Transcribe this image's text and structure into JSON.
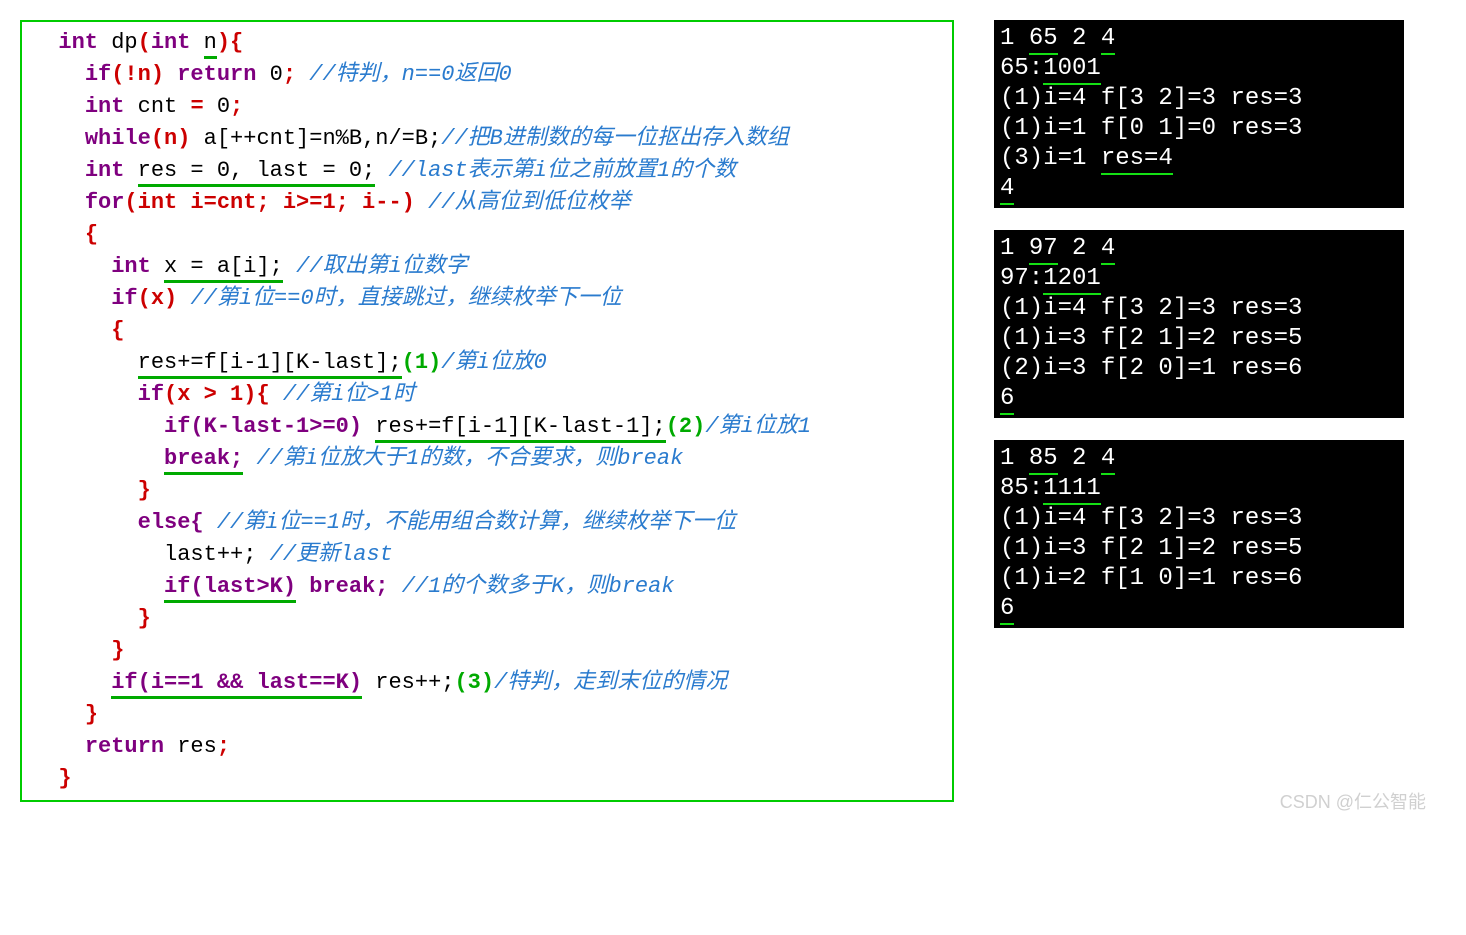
{
  "code": {
    "fn_sig": {
      "kw_int": "int",
      "name": "dp",
      "param_int": "int",
      "param_n": "n"
    },
    "l2": {
      "kw_if": "if",
      "cond": "(!n)",
      "kw_return": "return",
      "val": "0",
      "cm": "//特判，n==0返回0"
    },
    "l3": {
      "kw_int": "int",
      "var": "cnt",
      "eq": "=",
      "val": "0"
    },
    "l4": {
      "kw_while": "while",
      "cond": "(n)",
      "body": "a[++cnt]=n%B,n/=B;",
      "cm": "//把B进制数的每一位抠出存入数组"
    },
    "l5": {
      "kw_int": "int",
      "decl": "res = 0, last = 0;",
      "cm": "//last表示第i位之前放置1的个数"
    },
    "l6": {
      "kw_for": "for",
      "hdr": "(int i=cnt; i>=1; i--)",
      "cm": "//从高位到低位枚举"
    },
    "l8": {
      "kw_int": "int",
      "decl": "x = a[i];",
      "cm": "//取出第i位数字"
    },
    "l9": {
      "kw_if": "if",
      "cond": "(x)",
      "cm": "//第i位==0时，直接跳过，继续枚举下一位"
    },
    "l11": {
      "stmt": "res+=f[i-1][K-last];",
      "anno": "(1)",
      "cm": "/第i位放0"
    },
    "l12": {
      "kw_if": "if",
      "cond": "(x > 1){",
      "cm": "//第i位>1时"
    },
    "l13": {
      "cond": "if(K-last-1>=0)",
      "stmt": "res+=f[i-1][K-last-1];",
      "anno": "(2)",
      "cm": "/第i位放1"
    },
    "l14": {
      "kw_break": "break;",
      "cm": "//第i位放大于1的数，不合要求，则break"
    },
    "l16": {
      "kw_else": "else{",
      "cm": "//第i位==1时，不能用组合数计算，继续枚举下一位"
    },
    "l17": {
      "stmt": "last++;",
      "cm": "//更新last"
    },
    "l18": {
      "cond": "if(last>K)",
      "kw_break": "break;",
      "cm": "//1的个数多于K，则break"
    },
    "l21": {
      "cond": "if(i==1 && last==K)",
      "stmt": "res++;",
      "anno": "(3)",
      "cm": "/特判，走到末位的情况"
    },
    "l23": {
      "kw_return": "return",
      "var": "res"
    }
  },
  "terminals": [
    {
      "lines": [
        {
          "segments": [
            {
              "t": "1 "
            },
            {
              "t": "65",
              "u": true
            },
            {
              "t": " 2 "
            },
            {
              "t": "4",
              "u": true
            }
          ]
        },
        {
          "segments": [
            {
              "t": "65:"
            },
            {
              "t": "1001",
              "u": true
            }
          ]
        },
        {
          "segments": [
            {
              "t": "(1)i=4 f[3 2]=3 res=3"
            }
          ]
        },
        {
          "segments": [
            {
              "t": "(1)i=1 f[0 1]=0 res=3"
            }
          ]
        },
        {
          "segments": [
            {
              "t": "(3)i=1 "
            },
            {
              "t": "res=4",
              "u": true
            }
          ]
        },
        {
          "segments": [
            {
              "t": "4",
              "u": true
            }
          ]
        }
      ]
    },
    {
      "lines": [
        {
          "segments": [
            {
              "t": "1 "
            },
            {
              "t": "97",
              "u": true
            },
            {
              "t": " 2 "
            },
            {
              "t": "4",
              "u": true
            }
          ]
        },
        {
          "segments": [
            {
              "t": "97:"
            },
            {
              "t": "1201",
              "u": true
            }
          ]
        },
        {
          "segments": [
            {
              "t": "(1)i=4 f[3 2]=3 res=3"
            }
          ]
        },
        {
          "segments": [
            {
              "t": "(1)i=3 f[2 1]=2 res=5"
            }
          ]
        },
        {
          "segments": [
            {
              "t": "(2)i=3 f[2 0]=1 res=6"
            }
          ]
        },
        {
          "segments": [
            {
              "t": "6",
              "u": true
            }
          ]
        }
      ]
    },
    {
      "lines": [
        {
          "segments": [
            {
              "t": "1 "
            },
            {
              "t": "85",
              "u": true
            },
            {
              "t": " 2 "
            },
            {
              "t": "4",
              "u": true
            }
          ]
        },
        {
          "segments": [
            {
              "t": "85:"
            },
            {
              "t": "1111",
              "u": true
            }
          ]
        },
        {
          "segments": [
            {
              "t": "(1)i=4 f[3 2]=3 res=3"
            }
          ]
        },
        {
          "segments": [
            {
              "t": "(1)i=3 f[2 1]=2 res=5"
            }
          ]
        },
        {
          "segments": [
            {
              "t": "(1)i=2 f[1 0]=1 res=6"
            }
          ]
        },
        {
          "segments": [
            {
              "t": "6",
              "u": true
            }
          ]
        }
      ]
    }
  ],
  "watermark": "CSDN @仁公智能"
}
